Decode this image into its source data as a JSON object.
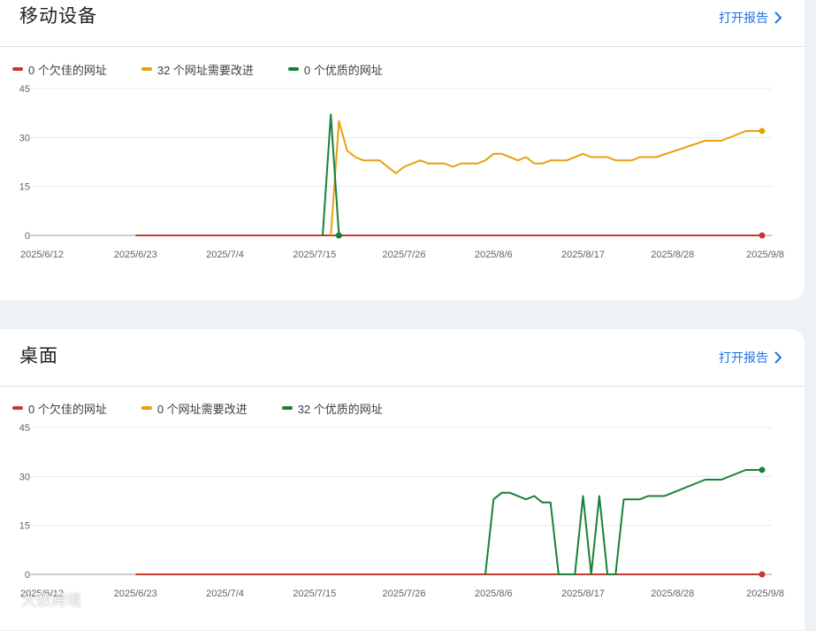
{
  "colors": {
    "poor": "#c5392f",
    "needs_improvement": "#e8a00e",
    "good": "#188038",
    "link": "#1a73e8",
    "grid": "#e8eaed"
  },
  "cards": [
    {
      "title": "移动设备",
      "open_report": "打开报告",
      "legend": [
        {
          "label": "0 个欠佳的网址",
          "color": "#c5392f"
        },
        {
          "label": "32 个网址需要改进",
          "color": "#e8a00e"
        },
        {
          "label": "0 个优质的网址",
          "color": "#188038"
        }
      ]
    },
    {
      "title": "桌面",
      "open_report": "打开报告",
      "legend": [
        {
          "label": "0 个欠佳的网址",
          "color": "#c5392f"
        },
        {
          "label": "0 个网址需要改进",
          "color": "#e8a00e"
        },
        {
          "label": "32 个优质的网址",
          "color": "#188038"
        }
      ]
    }
  ],
  "watermark": "大数跨境",
  "chart_data": [
    {
      "type": "line",
      "title": "移动设备",
      "ylim": [
        0,
        45
      ],
      "yticks": [
        "0",
        "15",
        "30",
        "45"
      ],
      "xticks": [
        "2025/6/12",
        "2025/6/23",
        "2025/7/4",
        "2025/7/15",
        "2025/7/26",
        "2025/8/6",
        "2025/8/17",
        "2025/8/28",
        "2025/9/8"
      ],
      "xlim": [
        "2025-06-12",
        "2025-09-08"
      ],
      "grid": true,
      "series": [
        {
          "name": "0 个欠佳的网址",
          "color": "#c5392f",
          "points": [
            [
              "2025-06-23",
              0
            ],
            [
              "2025-09-08",
              0
            ]
          ]
        },
        {
          "name": "32 个网址需要改进",
          "color": "#e8a00e",
          "points": [
            [
              "2025-07-17",
              0
            ],
            [
              "2025-07-18",
              35
            ],
            [
              "2025-07-19",
              26
            ],
            [
              "2025-07-20",
              24
            ],
            [
              "2025-07-21",
              23
            ],
            [
              "2025-07-23",
              23
            ],
            [
              "2025-07-25",
              19
            ],
            [
              "2025-07-26",
              21
            ],
            [
              "2025-07-28",
              23
            ],
            [
              "2025-07-29",
              22
            ],
            [
              "2025-07-31",
              22
            ],
            [
              "2025-08-01",
              21
            ],
            [
              "2025-08-02",
              22
            ],
            [
              "2025-08-04",
              22
            ],
            [
              "2025-08-05",
              23
            ],
            [
              "2025-08-06",
              25
            ],
            [
              "2025-08-07",
              25
            ],
            [
              "2025-08-09",
              23
            ],
            [
              "2025-08-10",
              24
            ],
            [
              "2025-08-11",
              22
            ],
            [
              "2025-08-12",
              22
            ],
            [
              "2025-08-13",
              23
            ],
            [
              "2025-08-15",
              23
            ],
            [
              "2025-08-17",
              25
            ],
            [
              "2025-08-18",
              24
            ],
            [
              "2025-08-20",
              24
            ],
            [
              "2025-08-21",
              23
            ],
            [
              "2025-08-23",
              23
            ],
            [
              "2025-08-24",
              24
            ],
            [
              "2025-08-26",
              24
            ],
            [
              "2025-09-01",
              29
            ],
            [
              "2025-09-03",
              29
            ],
            [
              "2025-09-06",
              32
            ],
            [
              "2025-09-08",
              32
            ]
          ]
        },
        {
          "name": "0 个优质的网址",
          "color": "#188038",
          "points": [
            [
              "2025-07-16",
              0
            ],
            [
              "2025-07-17",
              37
            ],
            [
              "2025-07-18",
              0
            ]
          ]
        }
      ]
    },
    {
      "type": "line",
      "title": "桌面",
      "ylim": [
        0,
        45
      ],
      "yticks": [
        "0",
        "15",
        "30",
        "45"
      ],
      "xticks": [
        "2025/6/12",
        "2025/6/23",
        "2025/7/4",
        "2025/7/15",
        "2025/7/26",
        "2025/8/6",
        "2025/8/17",
        "2025/8/28",
        "2025/9/8"
      ],
      "xlim": [
        "2025-06-12",
        "2025-09-08"
      ],
      "grid": true,
      "series": [
        {
          "name": "0 个欠佳的网址",
          "color": "#c5392f",
          "points": [
            [
              "2025-06-23",
              0
            ],
            [
              "2025-09-08",
              0
            ]
          ]
        },
        {
          "name": "0 个网址需要改进",
          "color": "#e8a00e",
          "points": []
        },
        {
          "name": "32 个优质的网址",
          "color": "#188038",
          "points": [
            [
              "2025-08-05",
              0
            ],
            [
              "2025-08-06",
              23
            ],
            [
              "2025-08-07",
              25
            ],
            [
              "2025-08-08",
              25
            ],
            [
              "2025-08-10",
              23
            ],
            [
              "2025-08-11",
              24
            ],
            [
              "2025-08-12",
              22
            ],
            [
              "2025-08-13",
              22
            ],
            [
              "2025-08-14",
              0
            ],
            [
              "2025-08-16",
              0
            ],
            [
              "2025-08-17",
              24
            ],
            [
              "2025-08-18",
              0
            ],
            [
              "2025-08-19",
              24
            ],
            [
              "2025-08-20",
              0
            ],
            [
              "2025-08-21",
              0
            ],
            [
              "2025-08-22",
              23
            ],
            [
              "2025-08-24",
              23
            ],
            [
              "2025-08-25",
              24
            ],
            [
              "2025-08-27",
              24
            ],
            [
              "2025-09-01",
              29
            ],
            [
              "2025-09-03",
              29
            ],
            [
              "2025-09-06",
              32
            ],
            [
              "2025-09-08",
              32
            ]
          ]
        }
      ]
    }
  ]
}
